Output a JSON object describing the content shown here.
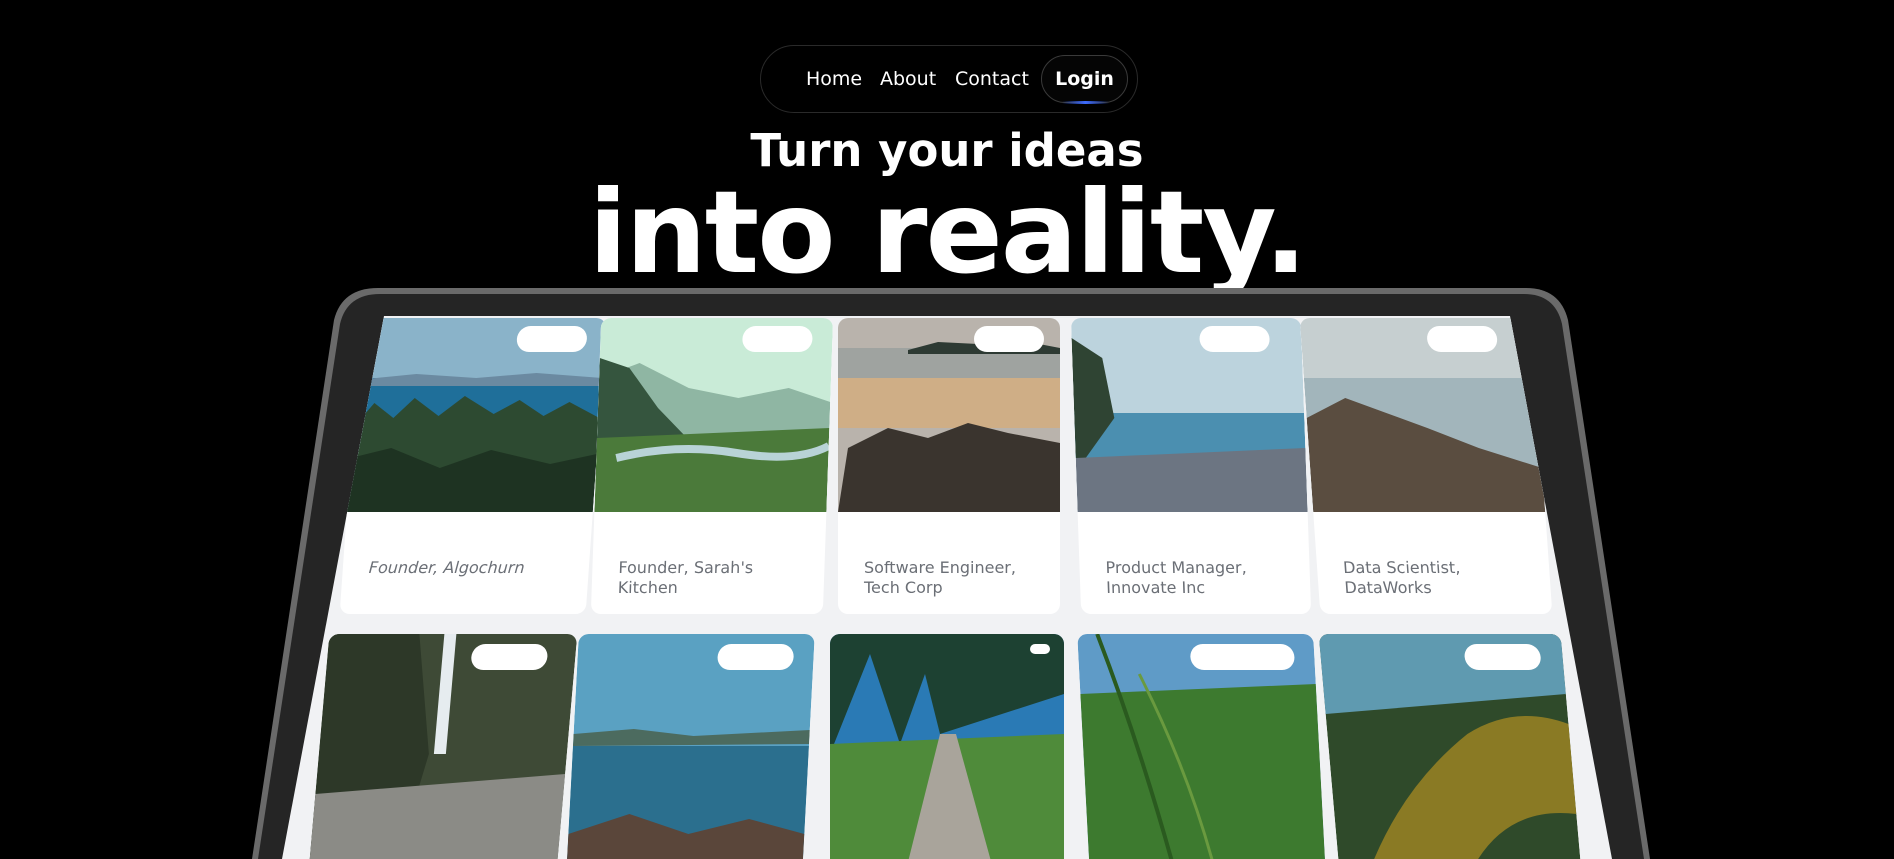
{
  "nav": {
    "home": "Home",
    "about": "About",
    "contact": "Contact",
    "login": "Login"
  },
  "hero": {
    "line1": "Turn your ideas",
    "line2": "into reality."
  },
  "cards_row1": [
    {
      "caption": "Founder, Algochurn"
    },
    {
      "caption": "Founder, Sarah's Kitchen"
    },
    {
      "caption": "Software Engineer, Tech Corp"
    },
    {
      "caption": "Product Manager, Innovate Inc"
    },
    {
      "caption": "Data Scientist, DataWorks"
    }
  ],
  "colors": {
    "background": "#000000",
    "frame": "#2a2a2a",
    "frame_edge": "#6a6a6a",
    "screen_bg": "#f1f2f4",
    "caption_text": "#6b6f76",
    "accent_glow": "#3d6bff"
  }
}
